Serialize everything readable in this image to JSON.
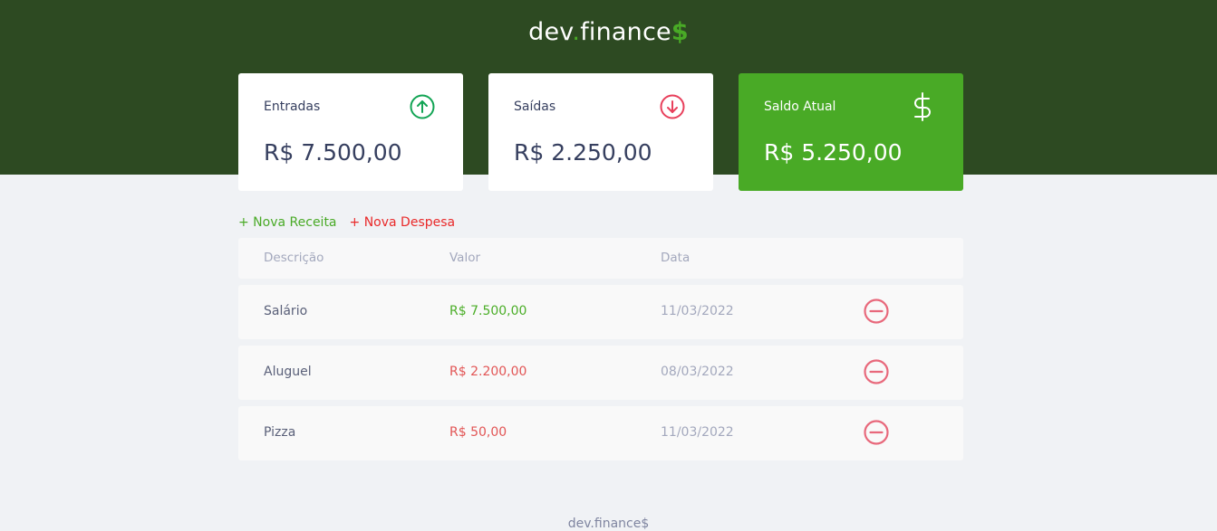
{
  "header": {
    "logo_main": "dev",
    "logo_dot": ".",
    "logo_rest": "finance",
    "logo_symbol": "$"
  },
  "cards": [
    {
      "label": "Entradas",
      "value": "R$ 7.500,00",
      "icon": "arrow-up-circle-icon"
    },
    {
      "label": "Saídas",
      "value": "R$ 2.250,00",
      "icon": "arrow-down-circle-icon"
    },
    {
      "label": "Saldo Atual",
      "value": "R$ 5.250,00",
      "icon": "dollar-sign-icon"
    }
  ],
  "actions": {
    "new_income": "+ Nova Receita",
    "new_expense": "+ Nova Despesa"
  },
  "table": {
    "headers": [
      "Descrição",
      "Valor",
      "Data"
    ],
    "rows": [
      {
        "description": "Salário",
        "amount": "R$ 7.500,00",
        "date": "11/03/2022",
        "type": "income"
      },
      {
        "description": "Aluguel",
        "amount": "R$ 2.200,00",
        "date": "08/03/2022",
        "type": "expense"
      },
      {
        "description": "Pizza",
        "amount": "R$ 50,00",
        "date": "11/03/2022",
        "type": "expense"
      }
    ]
  },
  "footer": {
    "text": "dev.finance$"
  },
  "colors": {
    "header_bg": "#2d4a22",
    "accent_green": "#49aa26",
    "expense_red": "#e92929",
    "text_dark": "#363f5f",
    "page_bg": "#f0f2f5"
  }
}
